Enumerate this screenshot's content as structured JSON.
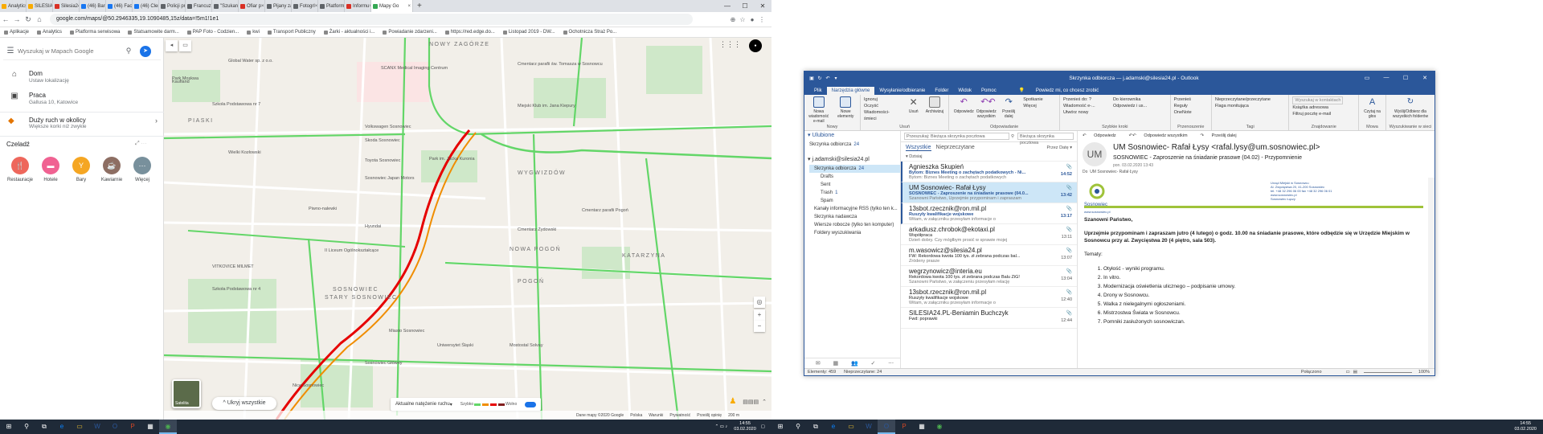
{
  "browser": {
    "tabs": [
      {
        "label": "Analytics",
        "color": "#f9ab00"
      },
      {
        "label": "SILESIA2",
        "color": "#f9ab00"
      },
      {
        "label": "Silesia24",
        "color": "#d93025"
      },
      {
        "label": "(46) Barc",
        "color": "#1877f2"
      },
      {
        "label": "(46) Face",
        "color": "#1877f2"
      },
      {
        "label": "(46) Clerc",
        "color": "#1877f2"
      },
      {
        "label": "Policji pr",
        "color": "#5f6368"
      },
      {
        "label": "Francuz",
        "color": "#5f6368"
      },
      {
        "label": "\"Szukan",
        "color": "#5f6368"
      },
      {
        "label": "Ofiar p",
        "color": "#d93025"
      },
      {
        "label": "Pijany za",
        "color": "#5f6368"
      },
      {
        "label": "Fotogrl",
        "color": "#5f6368"
      },
      {
        "label": "Platform",
        "color": "#5f6368"
      },
      {
        "label": "Informu",
        "color": "#d93025"
      },
      {
        "label": "Mapy Go",
        "color": "#34a853",
        "active": true
      }
    ],
    "new_tab": "+",
    "url": "google.com/maps/@50.2946335,19.1090485,15z/data=!5m1!1e1",
    "bookmarks": [
      "Aplikacje",
      "Analytics",
      "Platforma serwisowa",
      "Statsamowite darm...",
      "PAP Foto - Codzien...",
      "kwi",
      "Transport Publiczny",
      "Żarki - aktualności i...",
      "Powiadanie zdarzeni...",
      "https://red.edge.do...",
      "Listopad 2019 - DW...",
      "Ochotnicza Straż Po..."
    ]
  },
  "maps": {
    "search_placeholder": "Wyszukaj w Mapach Google",
    "home_title": "Dom",
    "home_sub": "Ustaw lokalizację",
    "work_title": "Praca",
    "work_sub": "Gallusa 10, Katowice",
    "traffic_title": "Duży ruch w okolicy",
    "traffic_sub": "Większe korki niż zwykle",
    "explore": "Czeladź",
    "categories": [
      {
        "label": "Restauracje",
        "color": "#ee675c",
        "icon": "fork-knife-icon"
      },
      {
        "label": "Hotele",
        "color": "#f06292",
        "icon": "bed-icon"
      },
      {
        "label": "Bary",
        "color": "#f5a623",
        "icon": "glass-icon"
      },
      {
        "label": "Kawiarnie",
        "color": "#8d6e63",
        "icon": "coffee-icon"
      },
      {
        "label": "Więcej",
        "color": "#78909c",
        "icon": "more-icon"
      }
    ],
    "districts": [
      "PIASKI",
      "NOWY ZAGÓRZE",
      "WYGWIZDÓW",
      "POGOŃ",
      "NOWA POGOŃ",
      "SOSNOWIEC",
      "STARY SOSNOWIEC",
      "KATARZYNA"
    ],
    "pois": [
      "Park Moskwa",
      "Kaufland",
      "Szkoła Podstawowa nr 7",
      "Global Water sp. z o.o.",
      "SCANX Medical Imaging Centrum",
      "Cmentarz parafii św. Tomasza w Sosnowcu",
      "Volkswagen Sosnowiec",
      "Skoda Sosnowiec",
      "Toyota Sosnowiec",
      "Sosnowiec Japan Motors",
      "Piwno-nalewki",
      "Hyundai",
      "Miejski Klub im. Jana Kiepury",
      "Wielki Kozłowski",
      "Park im. Jacka Kuronia",
      "Cmentarz parafii Pogoń",
      "Cmentarz Żydowski",
      "VITKOVICE MILMET",
      "Szkoła Podstawowa nr 4",
      "II Liceum Ogólnokształcące",
      "Miasto Sosnowiec",
      "Uniwersytet Śląski",
      "Sosnowiec Główny",
      "Mostostal Solvay",
      "Nice Sosnowiec"
    ],
    "layer_label": "Satelita",
    "hide_all": "Ukryj wszystkie",
    "traffic_mode": "Aktualne natężenie ruchu",
    "legend_fast": "Szybko",
    "legend_slow": "Wolno",
    "footer": [
      "Dane mapy ©2020 Google",
      "Polska",
      "Warunki",
      "Prywatność",
      "Prześlij opinię",
      "200 m"
    ]
  },
  "taskbar": {
    "time": "14:55",
    "date": "03.02.2020"
  },
  "outlook": {
    "title": "Skrzynka odbiorcza — j.adamski@silesia24.pl - Outlook",
    "tabs": [
      "Plik",
      "Narzędzia główne",
      "Wysyłanie/odbieranie",
      "Folder",
      "Widok",
      "Pomoc"
    ],
    "active_tab": "Narzędzia główne",
    "tell_me": "Powiedz mi, co chcesz zrobić",
    "ribbon": {
      "groups": [
        "Nowy",
        "Usuń",
        "Odpowiadanie",
        "Szybkie kroki",
        "Przenoszenie",
        "Tagi",
        "Znajdowanie",
        "Mowa",
        "Wyszukiwanie w sieci"
      ],
      "new_email": "Nowa wiadomość e-mail",
      "new_items": "Nowe elementy",
      "ignore": "Ignoruj",
      "clean": "Oczyść",
      "junk": "Wiadomości-śmieci",
      "delete": "Usuń",
      "archive": "Archiwizuj",
      "reply": "Odpowiedz",
      "reply_all": "Odpowiedz wszystkim",
      "forward": "Prześlij dalej",
      "meeting": "Spotkanie",
      "more": "Więcej",
      "qs1": "Przenieś do: ?",
      "qs2": "Wiadomość e-...",
      "qs3": "Utwórz nowy",
      "qs4": "Do kierownika",
      "qs5": "Odpowiedz i us...",
      "move": "Przenieś",
      "rules": "Reguły",
      "onenote": "OneNote",
      "unread": "Nieprzeczytane/przeczytane",
      "flag": "Flaga monitująca",
      "search_people": "Wyszukaj w kontaktach",
      "address_book": "Książka adresowa",
      "filter": "Filtruj pocztę e-mail",
      "read_aloud": "Czytaj na głos",
      "web": "Wyślij/Odbierz dla wszystkich folderów"
    },
    "folders": {
      "fav_header": "Ulubione",
      "fav_inbox": "Skrzynka odbiorcza",
      "fav_inbox_count": "24",
      "account": "j.adamski@silesia24.pl",
      "items": [
        {
          "label": "Skrzynka odbiorcza",
          "count": "24",
          "sel": true
        },
        {
          "label": "Drafts",
          "count": ""
        },
        {
          "label": "Sent",
          "count": ""
        },
        {
          "label": "Trash",
          "count": "1"
        },
        {
          "label": "Spam",
          "count": ""
        },
        {
          "label": "Kanały informacyjne RSS (tylko ten k...",
          "count": ""
        },
        {
          "label": "Skrzynka nadawcza",
          "count": ""
        },
        {
          "label": "Wiersze robocze (tylko ten komputer)",
          "count": ""
        },
        {
          "label": "Foldery wyszukiwania",
          "count": ""
        }
      ]
    },
    "list": {
      "search": "Przeszukaj: Bieżąca skrzynka pocztowa",
      "scope": "Bieżąca skrzynka pocztowa",
      "all": "Wszystkie",
      "unread": "Nieprzeczytane",
      "sort": "Przez Datę ▾",
      "group": "Dzisiaj",
      "messages": [
        {
          "from": "Agnieszka Skupień",
          "subj": "Bytom: Biznes Meeting o zachętach podatkowych - Ni...",
          "prev": "Bytom: Biznes Meeting o zachętach podatkowych",
          "time": "14:52",
          "unread": true,
          "sel": false
        },
        {
          "from": "UM Sosnowiec- Rafał Łysy",
          "subj": "SOSNOWIEC - Zaproszenie na śniadanie prasowe (04.0...",
          "prev": "Szanowni Państwo,  Uprzejmie przypominam i zapraszam",
          "time": "13:42",
          "unread": true,
          "sel": true
        },
        {
          "from": "13sbot.rzecznik@ron.mil.pl",
          "subj": "Ruszyły kwalifikacje wojskowe",
          "prev": "Witam,  w załączniku przesyłam informacje o",
          "time": "13:17",
          "unread": true,
          "sel": false
        },
        {
          "from": "arkadiusz.chrobok@ekotaxi.pl",
          "subj": "Współpraca",
          "prev": "Dzień dobry. Czy mógłbym prosić w sprawie mojej",
          "time": "13:11",
          "unread": false,
          "sel": false
        },
        {
          "from": "m.wasowicz@silesia24.pl",
          "subj": "FW: Rekordowa kwota 100 tys. zł zebrana podczas bal...",
          "prev": "Zródeny prasze",
          "time": "13:07",
          "unread": false,
          "sel": false
        },
        {
          "from": "wegrzynowicz@interia.eu",
          "subj": "Rekordowa kwota 100 tys. zł zebrana podczas Balu ZiG!",
          "prev": "Szanowni Państwo, w załączeniu przesyłam relację",
          "time": "13:04",
          "unread": false,
          "sel": false
        },
        {
          "from": "13sbot.rzecznik@ron.mil.pl",
          "subj": "Ruszyły kwalifikacje wojskowe",
          "prev": "Witam,  w załączniku przesyłam informacje o",
          "time": "12:40",
          "unread": false,
          "sel": false
        },
        {
          "from": "SILESIA24.PL-Beniamin Buchczyk",
          "subj": "Fwd: poprawki",
          "prev": "",
          "time": "12:44",
          "unread": false,
          "sel": false
        }
      ]
    },
    "reading": {
      "actions": [
        "Odpowiedz",
        "Odpowiedz wszystkim",
        "Prześlij dalej"
      ],
      "initials": "UM",
      "date": "pon. 03.02.2020 13:43",
      "from": "UM Sosnowiec- Rafał Łysy <rafal.lysy@um.sosnowiec.pl>",
      "subject": "SOSNOWIEC - Zaproszenie na śniadanie prasowe (04.02) - Przypomnienie",
      "to_label": "Do",
      "to": "UM Sosnowiec- Rafał Łysy",
      "logo_text": "Sosnowiec",
      "banner_lines": [
        "Urząd Miejski w Sosnowcu",
        "Al. Zwycięstwa 20, 41-200 Sosnowiec",
        "tel. +48 32 296 06 00 fax +48 32 296 06 01",
        "www.sosnowiec.pl",
        "Sosnowiec Łączy"
      ],
      "banner_url": "www.sosnowiec.pl",
      "greeting": "Szanowni Państwo,",
      "body": "Uprzejmie przypominam i zapraszam jutro (4 lutego) o godz. 10.00 na śniadanie prasowe, które odbędzie się w Urzędzie Miejskim w Sosnowcu przy al. Zwycięstwa 20 (4 piętro, sala 503).",
      "topics_label": "Tematy:",
      "topics": [
        "Otyłość - wyniki programu.",
        "In vitro.",
        "Modernizacja oświetlenia ulicznego – podpisanie umowy.",
        "Drony w Sosnowcu.",
        "Walka z nielegalnymi ogłoszeniami.",
        "Mistrzostwa Świata w Sosnowcu.",
        "Pomniki zasłużonych sosnowiczan."
      ]
    },
    "status": {
      "items": "Elementy: 459",
      "unread": "Nieprzeczytane: 24",
      "connected": "Połączono",
      "zoom": "100%"
    }
  }
}
